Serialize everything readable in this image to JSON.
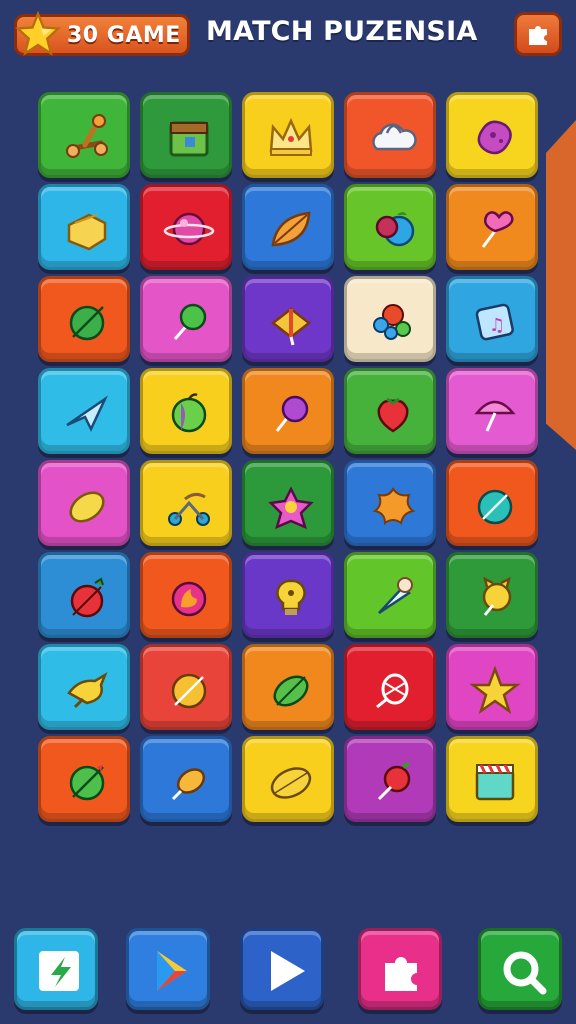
{
  "header": {
    "score_label": "30 GAME",
    "title": "MATCH PUZENSIA"
  },
  "board": {
    "rows": 8,
    "columns": 5,
    "tiles": [
      {
        "color": "#3fb53a",
        "icon": "catapult-icon"
      },
      {
        "color": "#2f9a3c",
        "icon": "treasure-box-icon"
      },
      {
        "color": "#f7cf1c",
        "icon": "crown-icon"
      },
      {
        "color": "#f0562a",
        "icon": "cloud-bag-icon"
      },
      {
        "color": "#f7d51e",
        "icon": "purple-blob-icon"
      },
      {
        "color": "#2fb6e8",
        "icon": "cheese-icon"
      },
      {
        "color": "#e11f2f",
        "icon": "pink-planet-icon"
      },
      {
        "color": "#2d78d8",
        "icon": "leaf-icon"
      },
      {
        "color": "#67c52a",
        "icon": "berries-icon"
      },
      {
        "color": "#f08a1e",
        "icon": "heart-lollipop-icon"
      },
      {
        "color": "#f0581e",
        "icon": "green-ball-icon"
      },
      {
        "color": "#e456c8",
        "icon": "green-lollipop-icon"
      },
      {
        "color": "#6f37c9",
        "icon": "spinning-top-icon"
      },
      {
        "color": "#f6e8c8",
        "icon": "flower-molecule-icon"
      },
      {
        "color": "#2fa6e0",
        "icon": "music-card-icon"
      },
      {
        "color": "#2fbde8",
        "icon": "paper-plane-icon"
      },
      {
        "color": "#f7cf1c",
        "icon": "apple-icon"
      },
      {
        "color": "#f0881e",
        "icon": "purple-lollipop-icon"
      },
      {
        "color": "#46b23c",
        "icon": "strawberry-icon"
      },
      {
        "color": "#e45ad0",
        "icon": "pink-mushroom-icon"
      },
      {
        "color": "#e452c8",
        "icon": "lemon-icon"
      },
      {
        "color": "#f7cf1c",
        "icon": "scooter-icon"
      },
      {
        "color": "#2c9a3a",
        "icon": "pink-flower-icon"
      },
      {
        "color": "#2e78d8",
        "icon": "orange-star-blob-icon"
      },
      {
        "color": "#f0581e",
        "icon": "teal-leaf-icon"
      },
      {
        "color": "#2d8ed6",
        "icon": "red-radish-icon"
      },
      {
        "color": "#f0581e",
        "icon": "fire-ball-icon"
      },
      {
        "color": "#6a38c8",
        "icon": "lightbulb-icon"
      },
      {
        "color": "#62c52a",
        "icon": "ice-cream-cone-icon"
      },
      {
        "color": "#2f9a3a",
        "icon": "yellow-cat-icon"
      },
      {
        "color": "#2fbde8",
        "icon": "yellow-bird-icon"
      },
      {
        "color": "#e8443a",
        "icon": "orange-ball-icon"
      },
      {
        "color": "#f0881e",
        "icon": "green-melon-icon"
      },
      {
        "color": "#e11f2f",
        "icon": "basket-icon"
      },
      {
        "color": "#e045c4",
        "icon": "gold-star-icon"
      },
      {
        "color": "#f0581e",
        "icon": "green-watermelon-icon"
      },
      {
        "color": "#2d78d8",
        "icon": "yellow-fruit-icon"
      },
      {
        "color": "#f7cf1c",
        "icon": "yellow-lemon-icon"
      },
      {
        "color": "#b03ab8",
        "icon": "red-cherry-icon"
      },
      {
        "color": "#f7d51e",
        "icon": "film-clapper-icon"
      }
    ]
  },
  "bottom_bar": [
    {
      "name": "boost-button",
      "color": "#2fb6e8",
      "icon": "lightning-icon"
    },
    {
      "name": "play-store-button",
      "color": "#2f7fe0",
      "icon": "play-store-icon"
    },
    {
      "name": "play-button",
      "color": "#2d62c8",
      "icon": "play-icon"
    },
    {
      "name": "puzzle-button",
      "color": "#e8308a",
      "icon": "puzzle-icon"
    },
    {
      "name": "search-button",
      "color": "#27a83a",
      "icon": "search-icon"
    }
  ]
}
